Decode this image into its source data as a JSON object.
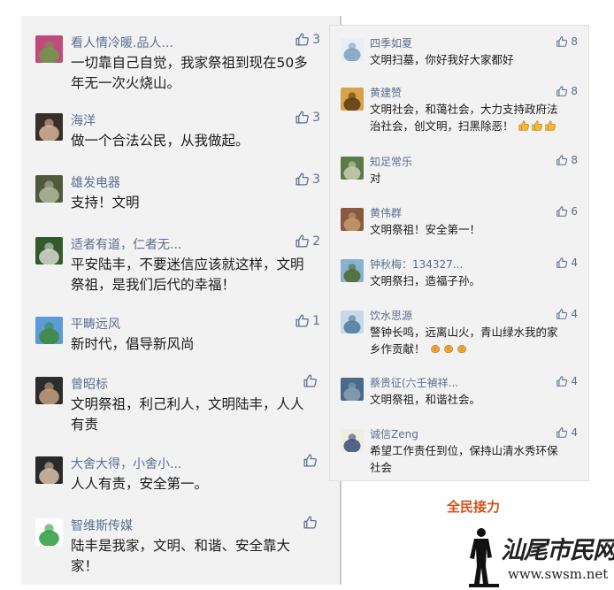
{
  "left_comments": [
    {
      "name": "看人情冷暖.品人...",
      "likes": "3",
      "lines": [
        "一切靠自己自觉，我家祭祖到现在50多",
        "年无一次火烧山。"
      ],
      "emoji": 0,
      "avatar": [
        "#c24a7a",
        "#6f9a4a"
      ]
    },
    {
      "name": "海洋",
      "likes": "3",
      "lines": [
        "做一个合法公民，从我做起。"
      ],
      "emoji": 0,
      "avatar": [
        "#3a2f28",
        "#d9b49a"
      ]
    },
    {
      "name": "雄发电器",
      "likes": "3",
      "lines": [
        "支持！文明"
      ],
      "emoji": 0,
      "avatar": [
        "#4e5a3b",
        "#b4b8a0"
      ]
    },
    {
      "name": "适者有道，仁者无...",
      "likes": "2",
      "lines": [
        "平安陆丰，不要迷信应该就这样，文明",
        "祭祖，是我们后代的幸福！"
      ],
      "emoji": 0,
      "avatar": [
        "#335a2b",
        "#d9d9d0"
      ]
    },
    {
      "name": "平畴远风",
      "likes": "1",
      "lines": [
        "新时代，倡导新风尚"
      ],
      "emoji": 0,
      "avatar": [
        "#5a9bd8",
        "#3f8a3a"
      ]
    },
    {
      "name": "曾昭标",
      "likes": "",
      "lines": [
        "文明祭祖，利己利人，文明陆丰，人人",
        "有责"
      ],
      "emoji": 0,
      "avatar": [
        "#2d2d2d",
        "#c8a080"
      ]
    },
    {
      "name": "大舍大得，小舍小...",
      "likes": "",
      "lines": [
        "人人有责，安全第一。"
      ],
      "emoji": 0,
      "avatar": [
        "#2a2a2a",
        "#d8c2a8"
      ]
    },
    {
      "name": "智维斯传媒",
      "likes": "",
      "lines": [
        "陆丰是我家，文明、和谐、安全靠大",
        "家！"
      ],
      "emoji": 0,
      "avatar": [
        "#ffffff",
        "#2e9a3e"
      ]
    }
  ],
  "right_comments": [
    {
      "name": "四季如夏",
      "likes": "8",
      "lines": [
        "文明扫墓，你好我好大家都好"
      ],
      "emoji": 0,
      "avatar": [
        "#e8eef4",
        "#7aa0c0"
      ]
    },
    {
      "name": "黄建赞",
      "likes": "8",
      "lines": [
        "文明社会，和蔼社会，大力支持政府法",
        "治社会，创文明，扫黑除恶！"
      ],
      "emoji": 3,
      "emoji_kind": "thumb",
      "avatar": [
        "#d8a24a",
        "#5a3a10"
      ]
    },
    {
      "name": "知足常乐",
      "likes": "8",
      "lines": [
        "对"
      ],
      "emoji": 0,
      "avatar": [
        "#5a7a4a",
        "#c8d0b0"
      ]
    },
    {
      "name": "黄伟群",
      "likes": "6",
      "lines": [
        "文明祭祖！安全第一！"
      ],
      "emoji": 0,
      "avatar": [
        "#8a5a40",
        "#c89a70"
      ]
    },
    {
      "name": "钟秋梅：134327...",
      "likes": "4",
      "lines": [
        "文明祭扫，造福子孙。"
      ],
      "emoji": 0,
      "avatar": [
        "#8ab0d0",
        "#4a6a2a"
      ]
    },
    {
      "name": "饮水思源",
      "likes": "4",
      "lines": [
        "警钟长鸣，远离山火，青山绿水我的家",
        "乡作贡献！"
      ],
      "emoji": 3,
      "emoji_kind": "fist",
      "avatar": [
        "#c8d8e8",
        "#4a7a9a"
      ]
    },
    {
      "name": "蔡贵征(六壬禎祥...",
      "likes": "4",
      "lines": [
        "文明祭祖，和谐社会。"
      ],
      "emoji": 0,
      "avatar": [
        "#4a6a8a",
        "#8aa0b0"
      ]
    },
    {
      "name": "诚信Zeng",
      "likes": "4",
      "lines": [
        "希望工作责任到位，保持山清水秀环保",
        "社会"
      ],
      "emoji": 0,
      "avatar": [
        "#f0eee0",
        "#3a4a7a"
      ]
    }
  ],
  "relay_label": "全民接力",
  "watermark": {
    "title": "汕尾市民网",
    "url": "www.swsm.net"
  },
  "colors": {
    "name": "#5a6f8f",
    "text": "#1a1a1a",
    "accent": "#d0531a",
    "panel": "#f2f2f3"
  },
  "icons": {
    "like": "thumbs-up-outline-icon",
    "emoji_thumb": "thumbs-up-emoji-icon",
    "emoji_fist": "fist-emoji-icon"
  }
}
